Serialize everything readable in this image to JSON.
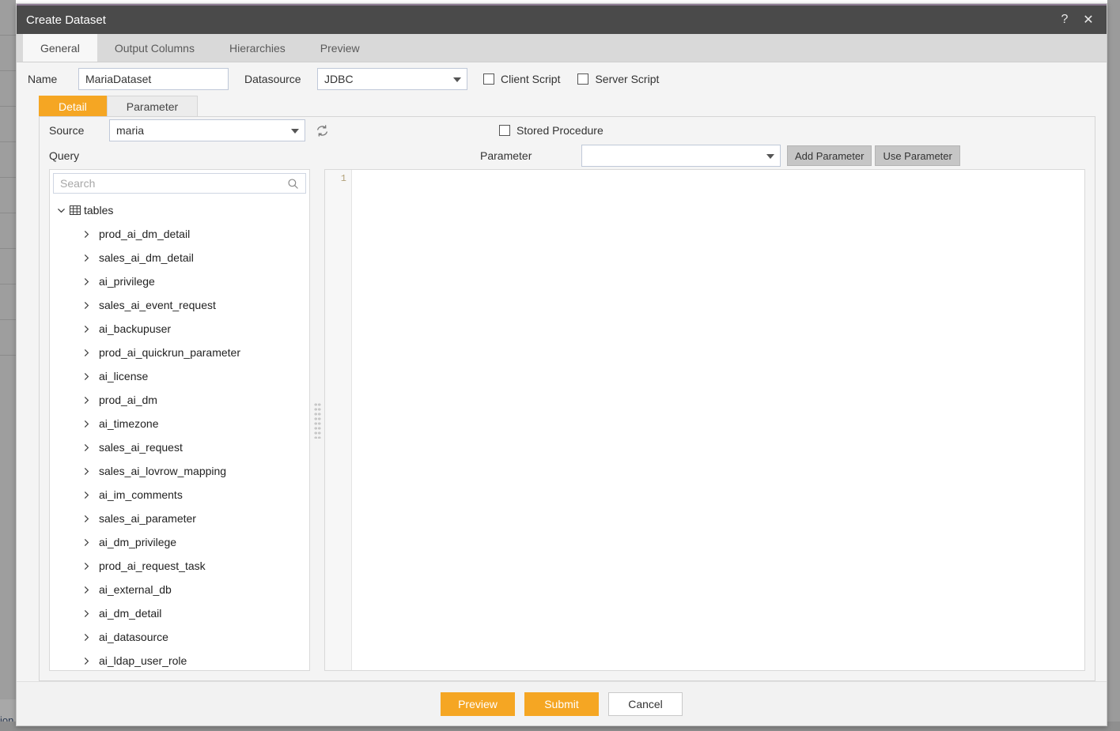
{
  "background": {
    "footer_label": "ion"
  },
  "window": {
    "title": "Create Dataset",
    "help_label": "?",
    "close_label": "✕"
  },
  "tabs": [
    {
      "label": "General",
      "active": true
    },
    {
      "label": "Output Columns",
      "active": false
    },
    {
      "label": "Hierarchies",
      "active": false
    },
    {
      "label": "Preview",
      "active": false
    }
  ],
  "form": {
    "name_label": "Name",
    "name_value": "MariaDataset",
    "name_placeholder": "",
    "datasource_label": "Datasource",
    "datasource_value": "JDBC",
    "client_script_label": "Client Script",
    "client_script_checked": false,
    "server_script_label": "Server Script",
    "server_script_checked": false
  },
  "subtabs": [
    {
      "label": "Detail",
      "active": true
    },
    {
      "label": "Parameter",
      "active": false
    }
  ],
  "detail": {
    "source_label": "Source",
    "source_value": "maria",
    "refresh_icon": "refresh-icon",
    "query_label": "Query",
    "stored_procedure_label": "Stored Procedure",
    "stored_procedure_checked": false,
    "parameter_label": "Parameter",
    "parameter_value": "",
    "add_parameter_label": "Add Parameter",
    "use_parameter_label": "Use Parameter"
  },
  "tree": {
    "search_placeholder": "Search",
    "search_value": "",
    "search_icon": "search-icon",
    "root_label": "tables",
    "root_icon": "table-grid-icon",
    "root_expanded": true,
    "items": [
      {
        "label": "prod_ai_dm_detail"
      },
      {
        "label": "sales_ai_dm_detail"
      },
      {
        "label": "ai_privilege"
      },
      {
        "label": "sales_ai_event_request"
      },
      {
        "label": "ai_backupuser"
      },
      {
        "label": "prod_ai_quickrun_parameter"
      },
      {
        "label": "ai_license"
      },
      {
        "label": "prod_ai_dm"
      },
      {
        "label": "ai_timezone"
      },
      {
        "label": "sales_ai_request"
      },
      {
        "label": "sales_ai_lovrow_mapping"
      },
      {
        "label": "ai_im_comments"
      },
      {
        "label": "sales_ai_parameter"
      },
      {
        "label": "ai_dm_privilege"
      },
      {
        "label": "prod_ai_request_task"
      },
      {
        "label": "ai_external_db"
      },
      {
        "label": "ai_dm_detail"
      },
      {
        "label": "ai_datasource"
      },
      {
        "label": "ai_ldap_user_role"
      }
    ]
  },
  "editor": {
    "line_number": "1",
    "content": ""
  },
  "footer": {
    "preview_label": "Preview",
    "submit_label": "Submit",
    "cancel_label": "Cancel"
  },
  "colors": {
    "accent": "#f5a623",
    "titlebar": "#4a4a4a",
    "tabbar": "#d9d9d9",
    "panel": "#f4f4f4"
  }
}
